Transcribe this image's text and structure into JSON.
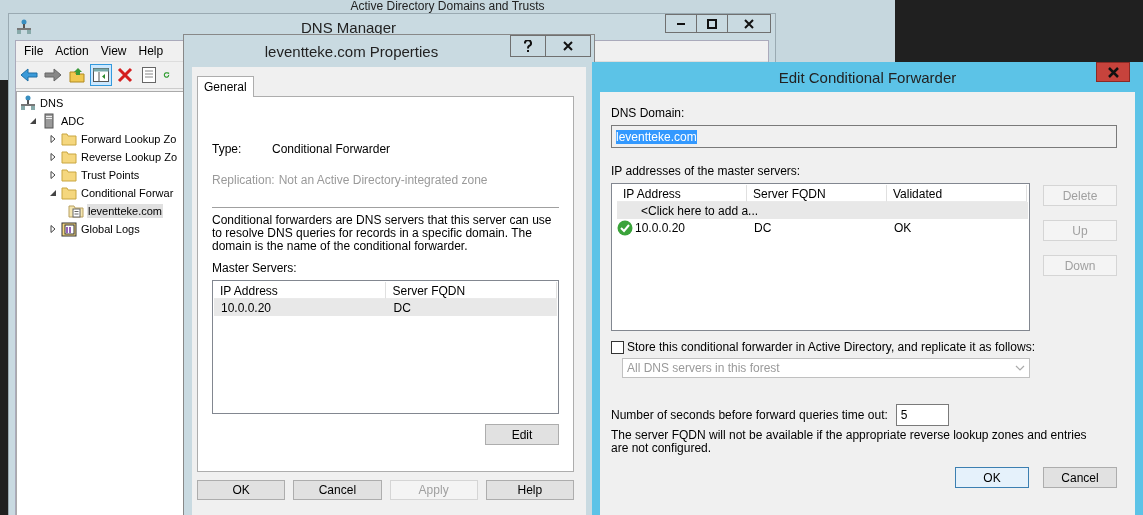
{
  "background_window": {
    "title": "Active Directory Domains and Trusts"
  },
  "dns_manager": {
    "title": "DNS Manager",
    "menu": [
      "File",
      "Action",
      "View",
      "Help"
    ],
    "toolbar": [
      {
        "kind": "back",
        "selected": false
      },
      {
        "kind": "forward",
        "selected": false
      },
      {
        "kind": "up",
        "selected": false
      },
      {
        "kind": "pane",
        "selected": true
      },
      {
        "kind": "delete",
        "selected": false
      },
      {
        "kind": "properties",
        "selected": false
      },
      {
        "kind": "refresh",
        "selected": false
      }
    ],
    "tree": [
      {
        "label": "DNS",
        "kind": "root",
        "selected": false,
        "children": [
          {
            "label": "ADC",
            "kind": "server",
            "expanded": true,
            "selected": false,
            "children": [
              {
                "label": "Forward Lookup Zo",
                "kind": "folder",
                "expanded": false,
                "selected": false
              },
              {
                "label": "Reverse Lookup Zo",
                "kind": "folder",
                "expanded": false,
                "selected": false
              },
              {
                "label": "Trust Points",
                "kind": "folder",
                "expanded": false,
                "selected": false
              },
              {
                "label": "Conditional Forwar",
                "kind": "folder",
                "expanded": true,
                "selected": false,
                "children": [
                  {
                    "label": "leventteke.com",
                    "kind": "zone",
                    "selected": true
                  }
                ]
              },
              {
                "label": "Global Logs",
                "kind": "logs",
                "expanded": false,
                "selected": false
              }
            ]
          }
        ]
      }
    ]
  },
  "properties": {
    "title": "leventteke.com Properties",
    "tabs": [
      {
        "label": "General",
        "selected": true
      }
    ],
    "type": {
      "label": "Type:",
      "value": "Conditional Forwarder"
    },
    "replication": {
      "label": "Replication:",
      "value": "Not an Active Directory-integrated zone",
      "disabled": true
    },
    "description": "Conditional forwarders are DNS servers that this server can use to resolve DNS queries for records in a specific domain.  The domain is the name of the conditional forwarder.",
    "master_servers_label": "Master Servers:",
    "table": {
      "columns": [
        "IP Address",
        "Server FQDN"
      ],
      "rows": [
        {
          "ip": "10.0.0.20",
          "fqdn": "DC",
          "selected": true
        }
      ]
    },
    "edit_button": "Edit",
    "buttons": [
      {
        "label": "OK",
        "disabled": false
      },
      {
        "label": "Cancel",
        "disabled": false
      },
      {
        "label": "Apply",
        "disabled": true
      },
      {
        "label": "Help",
        "disabled": false
      }
    ]
  },
  "edit_forwarder": {
    "title": "Edit Conditional Forwarder",
    "dns_domain": {
      "label": "DNS Domain:",
      "value": "leventteke.com",
      "selected": true
    },
    "ip_label": "IP addresses of the master servers:",
    "table": {
      "columns": [
        "IP Address",
        "Server FQDN",
        "Validated"
      ],
      "rows": [
        {
          "kind": "add",
          "ip": "<Click here to add a...",
          "selected": true
        },
        {
          "kind": "entry",
          "ip": "10.0.0.20",
          "fqdn": "DC",
          "validated": "OK",
          "selected": false
        }
      ]
    },
    "side_buttons": [
      {
        "label": "Delete",
        "disabled": true
      },
      {
        "label": "Up",
        "disabled": true
      },
      {
        "label": "Down",
        "disabled": true
      }
    ],
    "store_checkbox": {
      "label": "Store this conditional forwarder in Active Directory, and replicate it as follows:",
      "checked": false
    },
    "replication_dropdown": {
      "value": "All DNS servers in this forest",
      "disabled": true
    },
    "timeout": {
      "label": "Number of seconds before forward queries time out:",
      "value": "5"
    },
    "note": "The server FQDN will not be available if the appropriate reverse lookup zones and entries are not configured.",
    "buttons": [
      {
        "label": "OK",
        "default": true
      },
      {
        "label": "Cancel",
        "default": false
      }
    ]
  }
}
